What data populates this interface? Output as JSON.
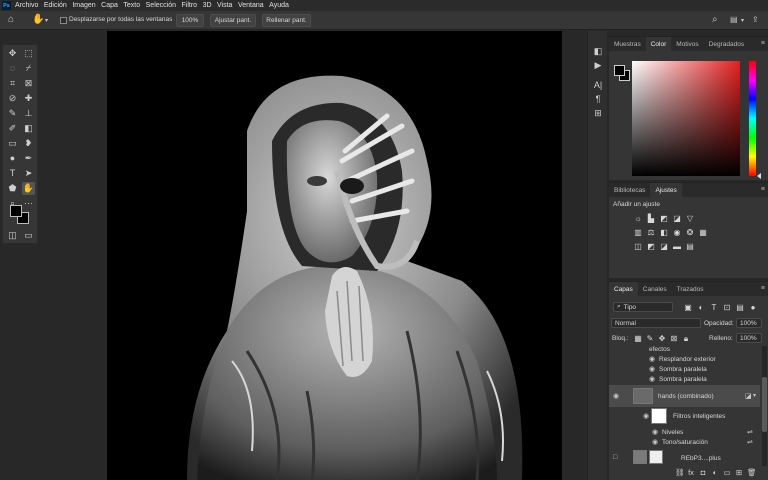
{
  "app": {
    "logo": "Ps"
  },
  "menu": [
    "Archivo",
    "Edición",
    "Imagen",
    "Capa",
    "Texto",
    "Selección",
    "Filtro",
    "3D",
    "Vista",
    "Ventana",
    "Ayuda"
  ],
  "options_bar": {
    "scroll_all_windows": "Desplazarse por todas las ventanas",
    "zoom_100": "100%",
    "fit_screen": "Ajustar pant.",
    "fill_screen": "Rellenar pant."
  },
  "color_panel": {
    "tabs": [
      "Muestras",
      "Color",
      "Motivos",
      "Degradados"
    ],
    "active_tab": "Color",
    "foreground": "#000000",
    "background": "#000000",
    "hue_color": "#e52020"
  },
  "adjust_panel": {
    "tabs": [
      "Bibliotecas",
      "Ajustes"
    ],
    "active_tab": "Ajustes",
    "title": "Añadir un ajuste"
  },
  "layers_panel": {
    "tabs": [
      "Capas",
      "Canales",
      "Trazados"
    ],
    "active_tab": "Capas",
    "filter": "Tipo",
    "blend_mode": "Normal",
    "opacity_label": "Opacidad:",
    "opacity_value": "100%",
    "lock_label": "Bloq.:",
    "fill_label": "Relleno:",
    "fill_value": "100%",
    "effects_label": "efectos",
    "effects": [
      "Resplandor exterior",
      "Sombra paralela",
      "Sombra paralela"
    ],
    "selected_layer": "hands (combinado)",
    "smart_filters": "Filtros inteligentes",
    "filters": [
      "Niveles",
      "Tono/saturación"
    ],
    "bottom_layer": "REbP3....plus"
  }
}
